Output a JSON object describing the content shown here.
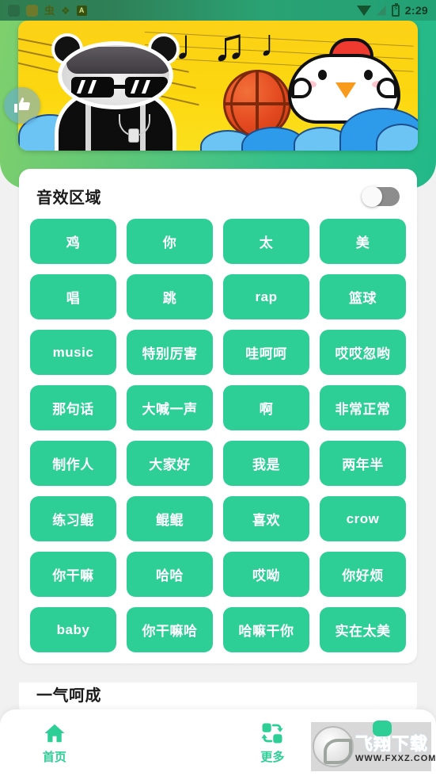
{
  "statusbar": {
    "time": "2:29",
    "left_icons": [
      "app-square-icon",
      "app-square-icon",
      "bug-icon",
      "brush-icon",
      "a-badge-icon"
    ],
    "right_icons": [
      "wifi-icon",
      "signal-off-icon",
      "battery-charging-icon"
    ]
  },
  "banner": {
    "alt": "panda-meme-basketball-chicken-banner",
    "elements": [
      "panda-meme-face",
      "music-notes",
      "basketball",
      "cartoon-chicken",
      "blue-waves"
    ]
  },
  "fab": {
    "name": "floating-share-button",
    "icon": "thumbs-up-icon"
  },
  "card": {
    "title": "音效区域",
    "toggle": {
      "name": "sound-zone-toggle",
      "state": "off"
    },
    "buttons": [
      "鸡",
      "你",
      "太",
      "美",
      "唱",
      "跳",
      "rap",
      "篮球",
      "music",
      "特别厉害",
      "哇呵呵",
      "哎哎忽哟",
      "那句话",
      "大喊一声",
      "啊",
      "非常正常",
      "制作人",
      "大家好",
      "我是",
      "两年半",
      "练习鲲",
      "鲲鲲",
      "喜欢",
      "crow",
      "你干嘛",
      "哈哈",
      "哎呦",
      "你好烦",
      "baby",
      "你干嘛哈",
      "哈嘛干你",
      "实在太美"
    ]
  },
  "section2": {
    "title": "一气呵成"
  },
  "bottomnav": {
    "items": [
      {
        "label": "首页",
        "icon": "home-icon",
        "active": true
      },
      {
        "label": "更多",
        "icon": "swap-icon",
        "active": false
      }
    ]
  },
  "watermark": {
    "brand": "飞翔下载",
    "url": "WWW.FXXZ.COM"
  },
  "colors": {
    "accent_green": "#2ecf96",
    "header_green": "#35c08b",
    "banner_yellow": "#fcd117",
    "page_bg": "#f1f1f1"
  }
}
